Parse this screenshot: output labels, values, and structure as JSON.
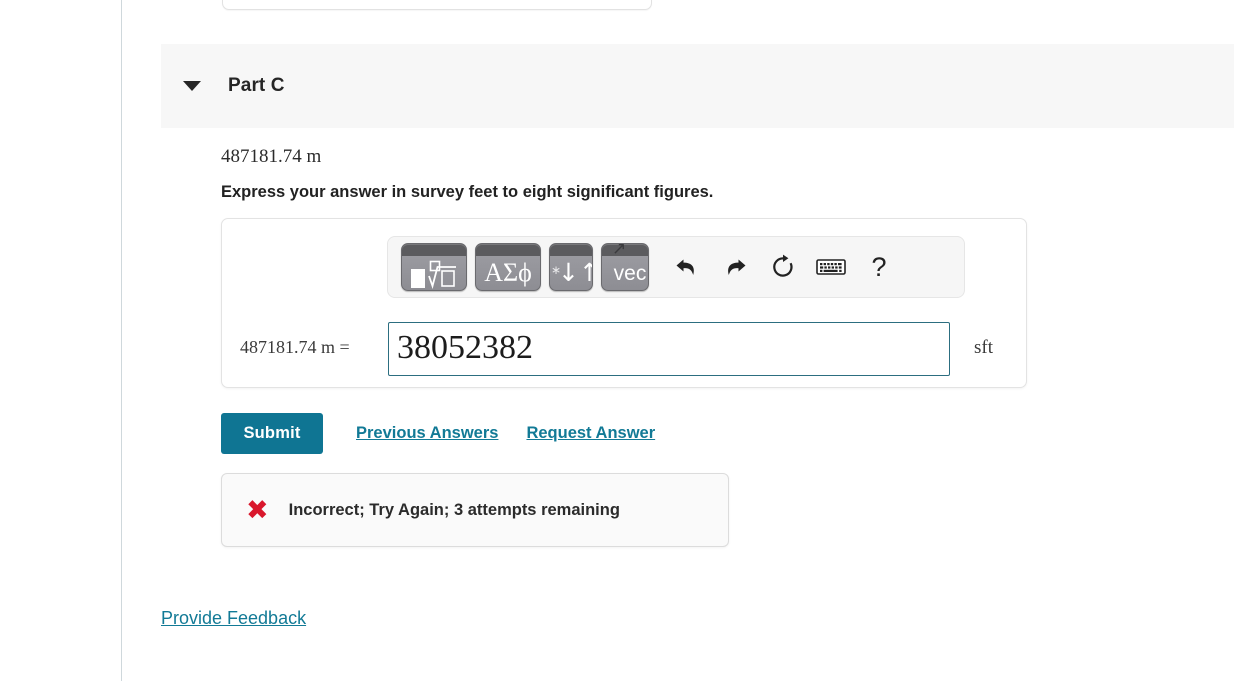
{
  "part": {
    "title": "Part C",
    "disclosure_icon": "triangle-down-icon",
    "expanded": true
  },
  "question": {
    "given_value": "487181.74 m",
    "prompt": "Express your answer in survey feet to eight significant figures."
  },
  "math_toolbar": {
    "buttons": [
      {
        "name": "template-square-root-button",
        "glyph": "√",
        "clipped_decoration": ""
      },
      {
        "name": "greek-symbols-button",
        "glyph": "ΑΣϕ",
        "clipped_decoration": ""
      },
      {
        "name": "units-arrows-button",
        "glyph": "↓↑",
        "clipped_decoration": "∗"
      },
      {
        "name": "vector-button",
        "glyph": "vec",
        "clipped_decoration": "↗"
      }
    ],
    "icons": [
      {
        "name": "undo-icon",
        "label": "undo"
      },
      {
        "name": "redo-icon",
        "label": "redo"
      },
      {
        "name": "reset-icon",
        "label": "reset"
      },
      {
        "name": "keyboard-icon",
        "label": "keyboard shortcuts"
      },
      {
        "name": "help-icon",
        "label": "?"
      }
    ]
  },
  "answer": {
    "equation_label": "487181.74 m =",
    "value": "38052382",
    "placeholder": "",
    "unit": "sft"
  },
  "actions": {
    "submit_label": "Submit",
    "previous_answers_label": "Previous Answers",
    "request_answer_label": "Request Answer"
  },
  "result": {
    "icon": "x-mark-icon",
    "icon_glyph": "✖",
    "message": "Incorrect; Try Again; 3 attempts remaining",
    "status_color": "#d9172c"
  },
  "footer": {
    "provide_feedback_label": "Provide Feedback"
  },
  "colors": {
    "accent": "#0f7593",
    "link": "#127a96",
    "header_bg": "#f7f7f7",
    "input_border": "#2c6e80",
    "error": "#d9172c"
  }
}
